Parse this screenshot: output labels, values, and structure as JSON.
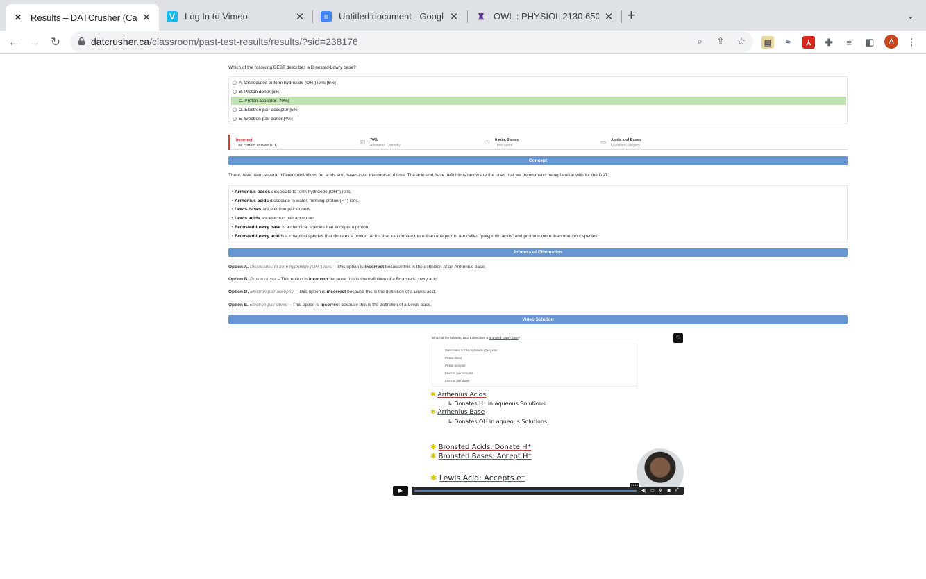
{
  "browser": {
    "tabs": [
      {
        "title": "Results – DATCrusher (Canadian",
        "icon": "datcrusher-icon",
        "active": true
      },
      {
        "title": "Log In to Vimeo",
        "icon": "vimeo-icon",
        "active": false
      },
      {
        "title": "Untitled document - Google Docs",
        "icon": "google-docs-icon",
        "active": false
      },
      {
        "title": "OWL : PHYSIOL 2130 650 SU22",
        "icon": "owl-icon",
        "active": false
      }
    ],
    "url_host": "datcrusher.ca",
    "url_path": "/classroom/past-test-results/results/?sid=238176",
    "avatar_letter": "A"
  },
  "question": {
    "text": "Which of the following BEST describes a Bronsted-Lowry base?",
    "choices": [
      {
        "label": "A. Dissociates to form hydroxide (OH-) ions [6%]",
        "correct": false
      },
      {
        "label": "B. Proton donor [6%]",
        "correct": false
      },
      {
        "label": "C. Proton acceptor [79%]",
        "correct": true
      },
      {
        "label": "D. Electron pair acceptor [5%]",
        "correct": false
      },
      {
        "label": "E. Electron pair donor [4%]",
        "correct": false
      }
    ]
  },
  "stats": {
    "result": "Incorrect",
    "result_sub": "The correct answer is: C.",
    "pct": "79%",
    "pct_sub": "Answered Correctly",
    "time": "0 min, 0 secs",
    "time_sub": "Time Spent",
    "category": "Acids and Bases",
    "category_sub": "Question Category"
  },
  "concept": {
    "heading": "Concept",
    "intro": "There have been several different definitions for acids and bases over the course of time. The acid and base definitions below are the ones that we recommend being familiar with for the DAT:",
    "items": [
      {
        "term": "Arrhenius bases",
        "text": " dissociate to form hydroxide (OH⁻) ions."
      },
      {
        "term": "Arrhenius acids",
        "text": " dissociate in water, forming proton (H⁺) ions."
      },
      {
        "term": "Lewis bases",
        "text": " are electron pair donors."
      },
      {
        "term": "Lewis acids",
        "text": " are electron pair acceptors."
      },
      {
        "term": "Bronsted-Lowry base",
        "text": " is a chemical species that accepts a proton."
      },
      {
        "term": "Bronsted-Lowry acid",
        "text": " is a chemical species that donates a proton. Acids that can donate more than one proton are called “polyprotic acids” and produce more than one ionic species."
      }
    ]
  },
  "elimination": {
    "heading": "Process of Elimination",
    "options": [
      {
        "opt": "Option A.",
        "choice": "Dissociates to form hydroxide (OH⁻) ions",
        "pre": " – This option is ",
        "verdict": "incorrect",
        "post": " because this is the definition of an Arrhenius base."
      },
      {
        "opt": "Option B.",
        "choice": "Proton donor",
        "pre": " – This option is ",
        "verdict": "incorrect",
        "post": " because this is the definition of a Bronsted-Lowry acid."
      },
      {
        "opt": "Option D.",
        "choice": "Electron pair acceptor",
        "pre": " – This option is ",
        "verdict": "incorrect",
        "post": " because this is the definition of a Lewis acid."
      },
      {
        "opt": "Option E.",
        "choice": "Electron pair donor",
        "pre": " – This option is ",
        "verdict": "incorrect",
        "post": " because this is the definition of a Lewis base."
      }
    ]
  },
  "video": {
    "heading": "Video Solution",
    "question_pre": "Which of the following BEST describes a ",
    "question_u": "Bronsted-Lowry base",
    "question_post": "?",
    "options": [
      "Dissociates to form hydroxide (OH-) ions",
      "Proton donor",
      "Proton acceptor",
      "Electron pair acceptor",
      "Electron pair donor"
    ],
    "notes": [
      "Arrhenius Acids",
      "↳ Donates H⁺ in aqueous Solutions",
      "Arrhenius Base",
      "↳ Donates OH in aqueous Solutions",
      "Bronsted Acids: Donate H⁺",
      "Bronsted Bases: Accept H⁺",
      "Lewis Acid: Accepts e⁻"
    ],
    "time": "01:18"
  }
}
